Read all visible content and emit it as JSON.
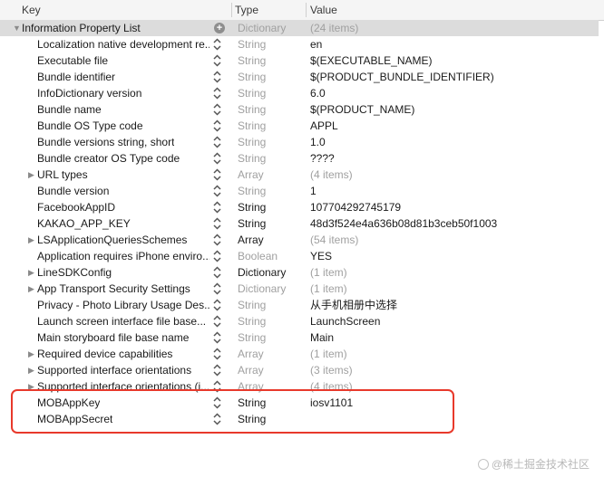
{
  "columns": {
    "key": "Key",
    "type": "Type",
    "value": "Value"
  },
  "rows": [
    {
      "key": "Information Property List",
      "type": "Dictionary",
      "value": "(24 items)",
      "kind": "root",
      "expandable": true,
      "expanded": true,
      "control": "add",
      "type_strong": false,
      "value_muted": true
    },
    {
      "key": "Localization native development re...",
      "type": "String",
      "value": "en",
      "expandable": false,
      "type_strong": false,
      "value_muted": false
    },
    {
      "key": "Executable file",
      "type": "String",
      "value": "$(EXECUTABLE_NAME)",
      "expandable": false,
      "type_strong": false,
      "value_muted": false
    },
    {
      "key": "Bundle identifier",
      "type": "String",
      "value": "$(PRODUCT_BUNDLE_IDENTIFIER)",
      "expandable": false,
      "type_strong": false,
      "value_muted": false
    },
    {
      "key": "InfoDictionary version",
      "type": "String",
      "value": "6.0",
      "expandable": false,
      "type_strong": false,
      "value_muted": false
    },
    {
      "key": "Bundle name",
      "type": "String",
      "value": "$(PRODUCT_NAME)",
      "expandable": false,
      "type_strong": false,
      "value_muted": false
    },
    {
      "key": "Bundle OS Type code",
      "type": "String",
      "value": "APPL",
      "expandable": false,
      "type_strong": false,
      "value_muted": false
    },
    {
      "key": "Bundle versions string, short",
      "type": "String",
      "value": "1.0",
      "expandable": false,
      "type_strong": false,
      "value_muted": false
    },
    {
      "key": "Bundle creator OS Type code",
      "type": "String",
      "value": "????",
      "expandable": false,
      "type_strong": false,
      "value_muted": false
    },
    {
      "key": "URL types",
      "type": "Array",
      "value": "(4 items)",
      "expandable": true,
      "type_strong": false,
      "value_muted": true
    },
    {
      "key": "Bundle version",
      "type": "String",
      "value": "1",
      "expandable": false,
      "type_strong": false,
      "value_muted": false
    },
    {
      "key": "FacebookAppID",
      "type": "String",
      "value": "107704292745179",
      "expandable": false,
      "type_strong": true,
      "value_muted": false
    },
    {
      "key": "KAKAO_APP_KEY",
      "type": "String",
      "value": "48d3f524e4a636b08d81b3ceb50f1003",
      "expandable": false,
      "type_strong": true,
      "value_muted": false
    },
    {
      "key": "LSApplicationQueriesSchemes",
      "type": "Array",
      "value": "(54 items)",
      "expandable": true,
      "type_strong": true,
      "value_muted": true
    },
    {
      "key": "Application requires iPhone enviro...",
      "type": "Boolean",
      "value": "YES",
      "expandable": false,
      "type_strong": false,
      "value_muted": false
    },
    {
      "key": "LineSDKConfig",
      "type": "Dictionary",
      "value": "(1 item)",
      "expandable": true,
      "type_strong": true,
      "value_muted": true
    },
    {
      "key": "App Transport Security Settings",
      "type": "Dictionary",
      "value": "(1 item)",
      "expandable": true,
      "type_strong": false,
      "value_muted": true
    },
    {
      "key": "Privacy - Photo Library Usage Des...",
      "type": "String",
      "value": "从手机相册中选择",
      "expandable": false,
      "type_strong": false,
      "value_muted": false
    },
    {
      "key": "Launch screen interface file base...",
      "type": "String",
      "value": "LaunchScreen",
      "expandable": false,
      "type_strong": false,
      "value_muted": false
    },
    {
      "key": "Main storyboard file base name",
      "type": "String",
      "value": "Main",
      "expandable": false,
      "type_strong": false,
      "value_muted": false
    },
    {
      "key": "Required device capabilities",
      "type": "Array",
      "value": "(1 item)",
      "expandable": true,
      "type_strong": false,
      "value_muted": true
    },
    {
      "key": "Supported interface orientations",
      "type": "Array",
      "value": "(3 items)",
      "expandable": true,
      "type_strong": false,
      "value_muted": true
    },
    {
      "key": "Supported interface orientations (i...",
      "type": "Array",
      "value": "(4 items)",
      "expandable": true,
      "type_strong": false,
      "value_muted": true
    },
    {
      "key": "MOBAppKey",
      "type": "String",
      "value": "iosv1101",
      "expandable": false,
      "type_strong": true,
      "value_muted": false
    },
    {
      "key": "MOBAppSecret",
      "type": "String",
      "value": "",
      "expandable": false,
      "type_strong": true,
      "value_muted": false
    }
  ],
  "watermark": "@稀土掘金技术社区",
  "colors": {
    "highlight": "#e8392b",
    "muted": "#a0a0a0"
  }
}
